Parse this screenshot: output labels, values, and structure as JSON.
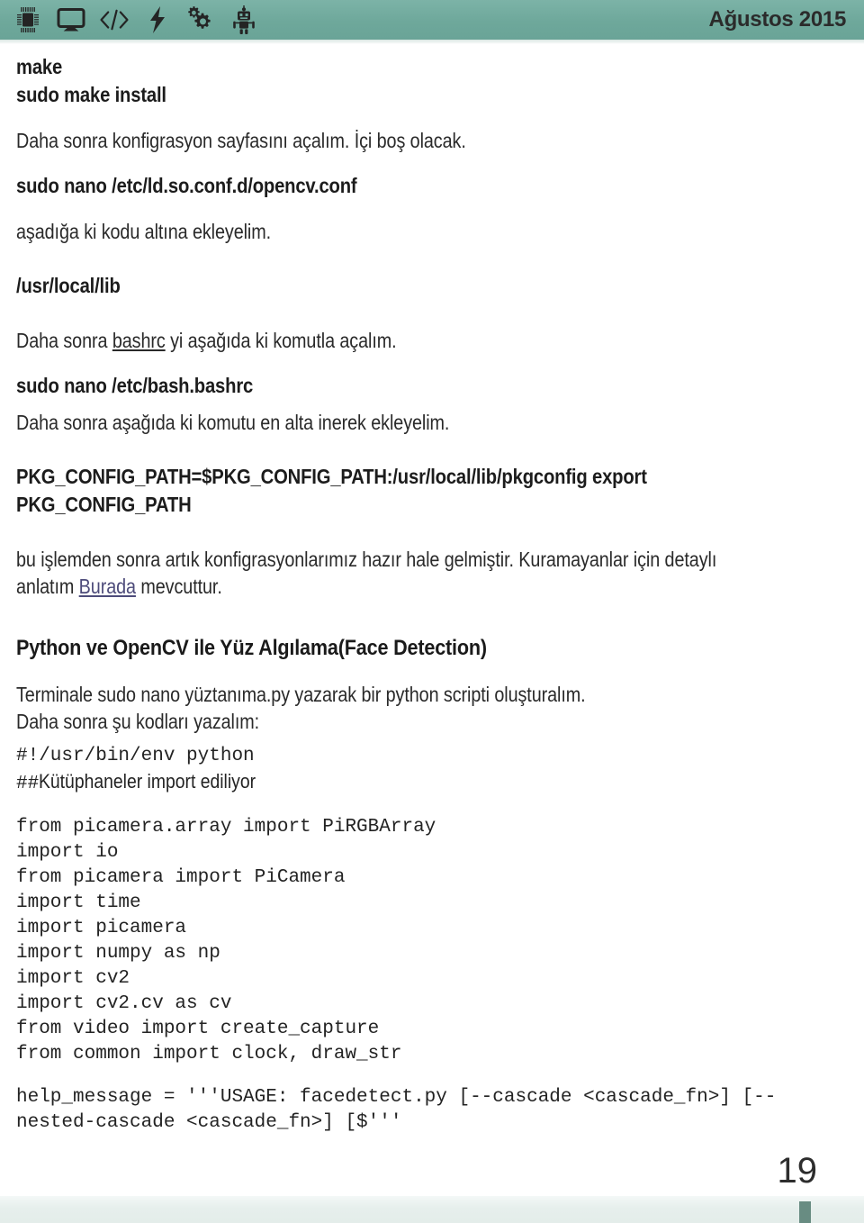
{
  "header": {
    "issue_date": "Ağustos 2015",
    "icons": [
      {
        "name": "chip-icon",
        "label": "chip"
      },
      {
        "name": "monitor-icon",
        "label": "monitor"
      },
      {
        "name": "code-brackets-icon",
        "label": "</>"
      },
      {
        "name": "lightning-bolt-icon",
        "label": "bolt"
      },
      {
        "name": "gears-icon",
        "label": "gears"
      },
      {
        "name": "robot-icon",
        "label": "robot"
      }
    ],
    "accent_color": "#6ea89b"
  },
  "article": {
    "cmd_make": "make\nsudo make install",
    "p_config_page": "Daha sonra konfigrasyon sayfasını açalım. İçi boş olacak.",
    "cmd_nano_opencv_conf": "sudo nano /etc/ld.so.conf.d/opencv.conf",
    "p_add_code_below": "aşadığa ki kodu altına ekleyelim.",
    "cmd_usr_local_lib": "/usr/local/lib",
    "p_bashrc_prefix": "Daha sonra ",
    "p_bashrc_link": "bashrc",
    "p_bashrc_suffix": " yi aşağıda ki komutla açalım.",
    "cmd_nano_bash_bashrc": "sudo nano /etc/bash.bashrc",
    "p_add_bottom": "Daha sonra aşağıda ki komutu en alta inerek ekleyelim.",
    "cmd_pkg_config": "PKG_CONFIG_PATH=$PKG_CONFIG_PATH:/usr/local/lib/pkgconfig export PKG_CONFIG_PATH",
    "p_done_prefix": "bu işlemden sonra artık konfigrasyonlarımız hazır hale gelmiştir. Kuramayanlar için detaylı anlatım ",
    "p_done_link": "Burada",
    "p_done_suffix": " mevcuttur.",
    "link_color": "#4d4b7a",
    "h2_face_detection": "Python ve OpenCV ile Yüz Algılama(Face Detection)",
    "p_terminal": "Terminale sudo nano yüztanıma.py yazarak bir python scripti oluşturalım.\nDaha sonra şu kodları yazalım:",
    "shebang": "#!/usr/bin/env python",
    "comment_hashes": "##",
    "comment_text": "Kütüphaneler import ediliyor",
    "code_imports": "from picamera.array import PiRGBArray\nimport io\nfrom picamera import PiCamera\nimport time\nimport picamera\nimport numpy as np\nimport cv2\nimport cv2.cv as cv\nfrom video import create_capture\nfrom common import clock, draw_str",
    "code_help_message": "help_message = '''USAGE: facedetect.py [--cascade <cascade_fn>] [--nested-cascade <cascade_fn>] [$'''"
  },
  "footer": {
    "page_number": "19",
    "tick_color": "#688c82"
  }
}
